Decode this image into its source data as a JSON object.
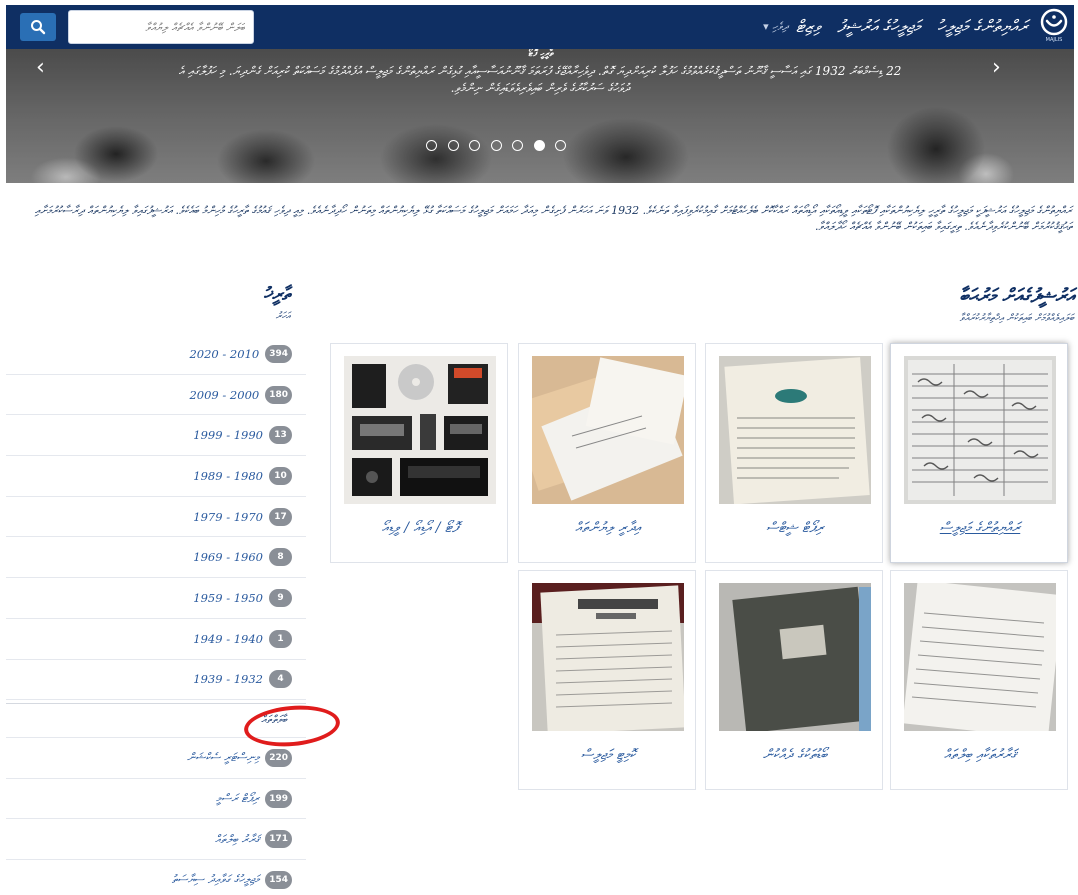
{
  "header": {
    "search_placeholder": "ބަލަން ބޭނުންވާ އެއްޗެއް ލިޔުއްވާ",
    "language": "ދިވެހި",
    "nav": [
      "ރައްޔިތުންގެ މަޖިލީހު",
      "މަޖިލީހުގެ އަރުޝީފު",
      "ވިޒިޓް"
    ],
    "logo_caption": "MAJLIS"
  },
  "hero": {
    "title": "ތާރީހީ ފޮޓޯ",
    "caption": "22 ޑިސެމްބަރު 1932 ގައި އަސާސީ ޤާނޫނު ތަސްދީޤުކުރެއްވުމުގެ ހަފުލާ ކުރިއަށްދިޔަ ގޮތް. ދިވެހިރާއްޖޭގެ ފުރަތަމަ ޤާނޫނުއަސާސީއާއި ގުޅިގެން ރައްޔިތުންގެ މަޖިލީސް އުފެއްދުމުގެ މަސައްކަތް ކުރިއަށް ގެންދިޔަ. މި ހަފުލާގައި އެ ދުވަހުގެ ސަރުކާރުގެ ވެރިން ބައިވެރިވެވަޑައިގެން ނިންމެވި.",
    "active_slide": 6,
    "slide_count": 7
  },
  "intro": {
    "text": "ރައްޔިތުންގެ މަޖިލީހުގެ އަރުޝީފަކީ މަޖިލީހުގެ ތާރީހީ ލިޔެކިޔުންތަކާއި ފޮޓޯތަކާއި ވީޑިއޯތަކާއި އޯޑިއޯތައް ރައްކާކޮށް ބެލެހެއްޓުމަށް ގާއިމުކުރެވިފައިވާ ތަނެކެވެ. 1932 ވަނަ އަހަރުން ފެށިގެން މިއަދާ ހަމައަށް މަޖިލީހުގެ މަސައްކަތާ ގުޅޭ ލިޔެކިޔުންތައް މިތަނުން ހޯދިދާނެއެވެ. މިއީ ދިވެހި ޤައުމުގެ ތާރީހުގެ މުހިންމު ބައެކެވެ. އަރުޝީފުގައިވާ ލިޔެކިޔުންތައް ދިރާސާކުރުމަށާއި ތަޙުޤީޤުކުރުމަށް ބޭނުންކުރެވިދާނެއެވެ. ތިރީގައިވާ ބައިތަކުން ބޭނުންވާ އެއްޗެއް ހޯދާލައްވާ."
  },
  "collections": {
    "title": "އަރުޝީފުގެއަށް މަރުޙަބާ",
    "subtitle": "ބަލައިލެއްވުމަށް ބައިތަކުން އިޚްތިޔާރުކުރައްވާ",
    "cards": [
      {
        "label": "ރައްޔިތުންގެ މަޖިލީސް",
        "active": true
      },
      {
        "label": "ރިޕޯޓް ޝީޓްސް"
      },
      {
        "label": "އިދާރީ ލިޔުންތައް"
      },
      {
        "label": "ފޮޓޯ / އޯޑިއޯ / ވީޑިއޯ"
      },
      {
        "label": "ޤަރާރުތަކާއި ބިލްތައް"
      },
      {
        "label": "ބޯޑުތަކުގެ ދެއްކުން"
      },
      {
        "label": "ކޮމިޓީ މަޖިލީސް"
      }
    ]
  },
  "sidebar": {
    "title": "ތާރީޚު",
    "subtitle": "އަހަރު",
    "years": [
      {
        "label": "2020 - 2010",
        "count": "394"
      },
      {
        "label": "2009 - 2000",
        "count": "180"
      },
      {
        "label": "1999 - 1990",
        "count": "13"
      },
      {
        "label": "1989 - 1980",
        "count": "10"
      },
      {
        "label": "1979 - 1970",
        "count": "17"
      },
      {
        "label": "1969 - 1960",
        "count": "8"
      },
      {
        "label": "1959 - 1950",
        "count": "9"
      },
      {
        "label": "1949 - 1940",
        "count": "1"
      },
      {
        "label": "1939 - 1932",
        "count": "4"
      }
    ],
    "categories_label": "ބާވަތްތައް",
    "categories": [
      {
        "label": "މިނިސްޓަރީ ސެކްޝަން",
        "count": "220"
      },
      {
        "label": "ރިޕޯޓް ރަސްމީ",
        "count": "199"
      },
      {
        "label": "ޤަރާރު ބިލްތައް",
        "count": "171"
      },
      {
        "label": "މަޖިލީހުގެ ގަވާއިދު ސިޔާސަތު",
        "count": "154"
      }
    ]
  },
  "colors": {
    "navbar": "#0f2f63",
    "search_button": "#2a6fb5",
    "link": "#2a5a9e",
    "badge": "#8a8f97",
    "highlight_ring": "#e01c1c"
  }
}
